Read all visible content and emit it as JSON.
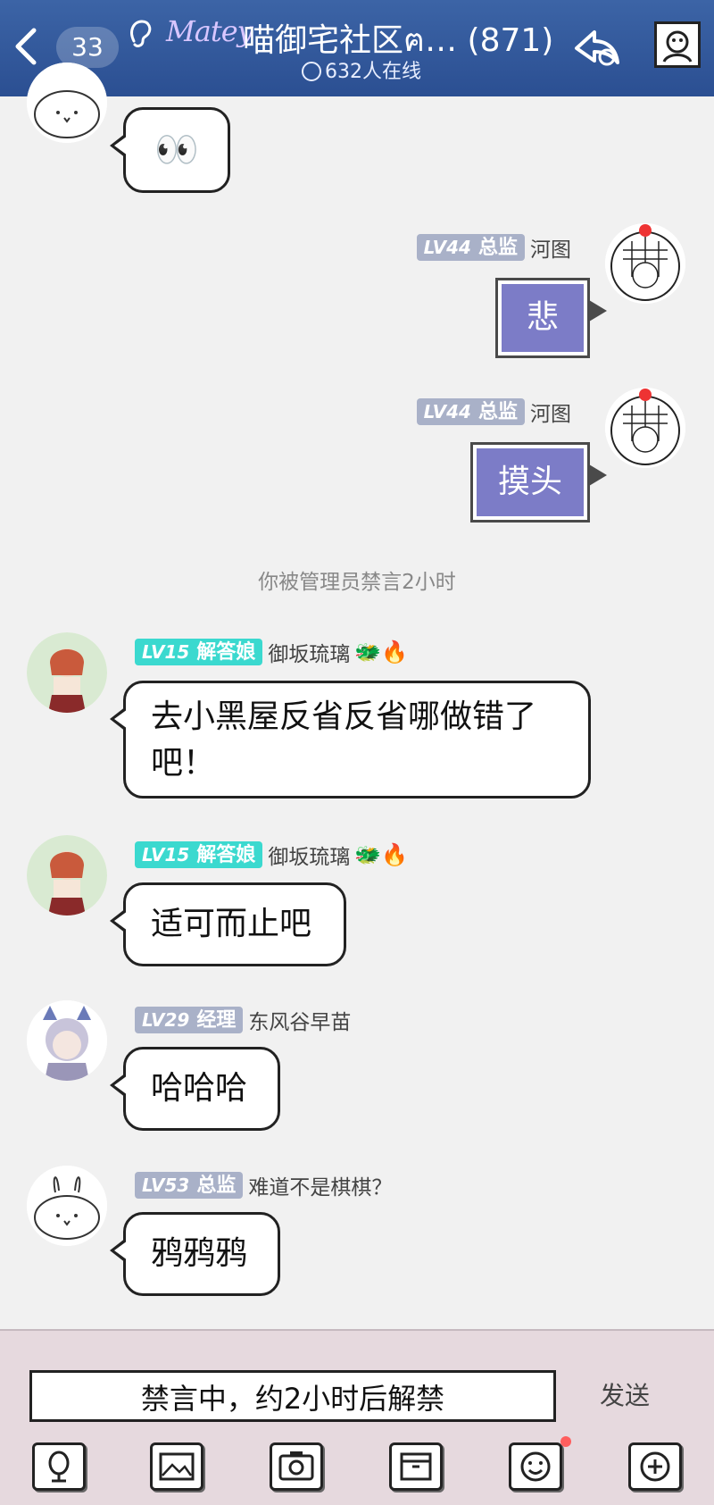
{
  "header": {
    "unread_count": "33",
    "logo_text": "Matey",
    "title": "喵御宅社区ฅ… (871)",
    "online_text": "632人在线"
  },
  "messages": [
    {
      "id": "m1",
      "side": "left",
      "text": "👀"
    },
    {
      "id": "m2",
      "side": "right",
      "level": "LV44",
      "rank": "总监",
      "user": "河图",
      "text": "悲"
    },
    {
      "id": "m3",
      "side": "right",
      "level": "LV44",
      "rank": "总监",
      "user": "河图",
      "text": "摸头"
    },
    {
      "id": "m5",
      "side": "left",
      "level": "LV15",
      "rank": "解答娘",
      "user": "御坂琉璃",
      "text_line1": "去小黑屋反省反省哪做错了",
      "text_line2": "吧！"
    },
    {
      "id": "m6",
      "side": "left",
      "level": "LV15",
      "rank": "解答娘",
      "user": "御坂琉璃",
      "text": "适可而止吧"
    },
    {
      "id": "m7",
      "side": "left",
      "level": "LV29",
      "rank": "经理",
      "user": "东风谷早苗",
      "text": "哈哈哈"
    },
    {
      "id": "m8",
      "side": "left",
      "level": "LV53",
      "rank": "总监",
      "user": "难道不是棋棋？",
      "text": "鸦鸦鸦"
    }
  ],
  "system_notice": "你被管理员禁言2小时",
  "user_decorations": "🐲🔥",
  "input": {
    "muted_text": "禁言中，约2小时后解禁",
    "send_label": "发送"
  },
  "toolbar": [
    "voice-icon",
    "image-icon",
    "camera-icon",
    "box-icon",
    "emoji-icon",
    "plus-icon"
  ],
  "colors": {
    "header": "#2f559a",
    "right_bubble": "#7c7cc7",
    "level_gray": "#a9b1c8",
    "level_cyan": "#3bd9cf",
    "input_bg": "#e6d9de"
  }
}
